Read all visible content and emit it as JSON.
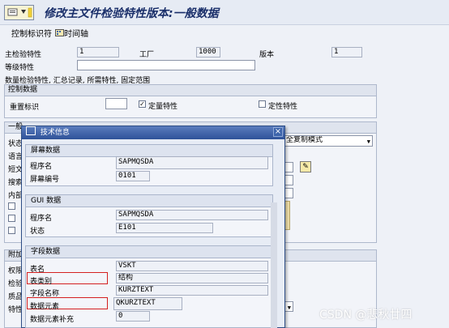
{
  "window": {
    "title": "修改主文件检验特性版本:一般数据"
  },
  "toolbar": {
    "control_label": "控制标识符",
    "timeline_label": "时间轴"
  },
  "header": {
    "master_char_label": "主检验特性",
    "master_char_value": "1",
    "plant_label": "工厂",
    "plant_value": "1000",
    "version_label": "版本",
    "version_value": "1",
    "level_label": "等级特性",
    "level_value": "",
    "summary_text": "数量检验特性, 汇总记录, 所需特性, 固定范围"
  },
  "control_data": {
    "heading": "控制数据",
    "reset_label": "重置标识",
    "reset_value": "",
    "quant_checked": true,
    "quant_label": "定量特性",
    "qual_checked": false,
    "qual_label": "定性特性"
  },
  "general": {
    "heading": "一般",
    "status_label": "状态",
    "language_label": "语言",
    "short_text_label": "短文",
    "search_label": "搜索",
    "inner_label": "内部",
    "copy_mode_value": "全复制模式"
  },
  "additional": {
    "heading": "附加",
    "perm_label": "权限",
    "inspect_label": "检验",
    "sample_label": "质品",
    "char_label": "特性"
  },
  "dialog": {
    "title": "技术信息",
    "screen": {
      "heading": "屏幕数据",
      "program_label": "程序名",
      "program_value": "SAPMQSDA",
      "screen_no_label": "屏幕编号",
      "screen_no_value": "0101"
    },
    "gui": {
      "heading": "GUI 数据",
      "program_label": "程序名",
      "program_value": "SAPMQSDA",
      "status_label": "状态",
      "status_value": "E101"
    },
    "field": {
      "heading": "字段数据",
      "table_label": "表名",
      "table_value": "VSKT",
      "table_cat_label": "表类别",
      "table_cat_value": "结构",
      "field_name_label": "字段名称",
      "field_name_value": "KURZTEXT",
      "data_elem_label": "数据元素",
      "data_elem_value": "QKURZTEXT",
      "data_elem_supp_label": "数据元素补充",
      "data_elem_supp_value": "0"
    }
  },
  "watermark": "CSDN @悲秋廿四",
  "colors": {
    "title_text": "#1a2f6a",
    "dialog_title_bg": "#2f5299",
    "highlight": "#d42020"
  }
}
